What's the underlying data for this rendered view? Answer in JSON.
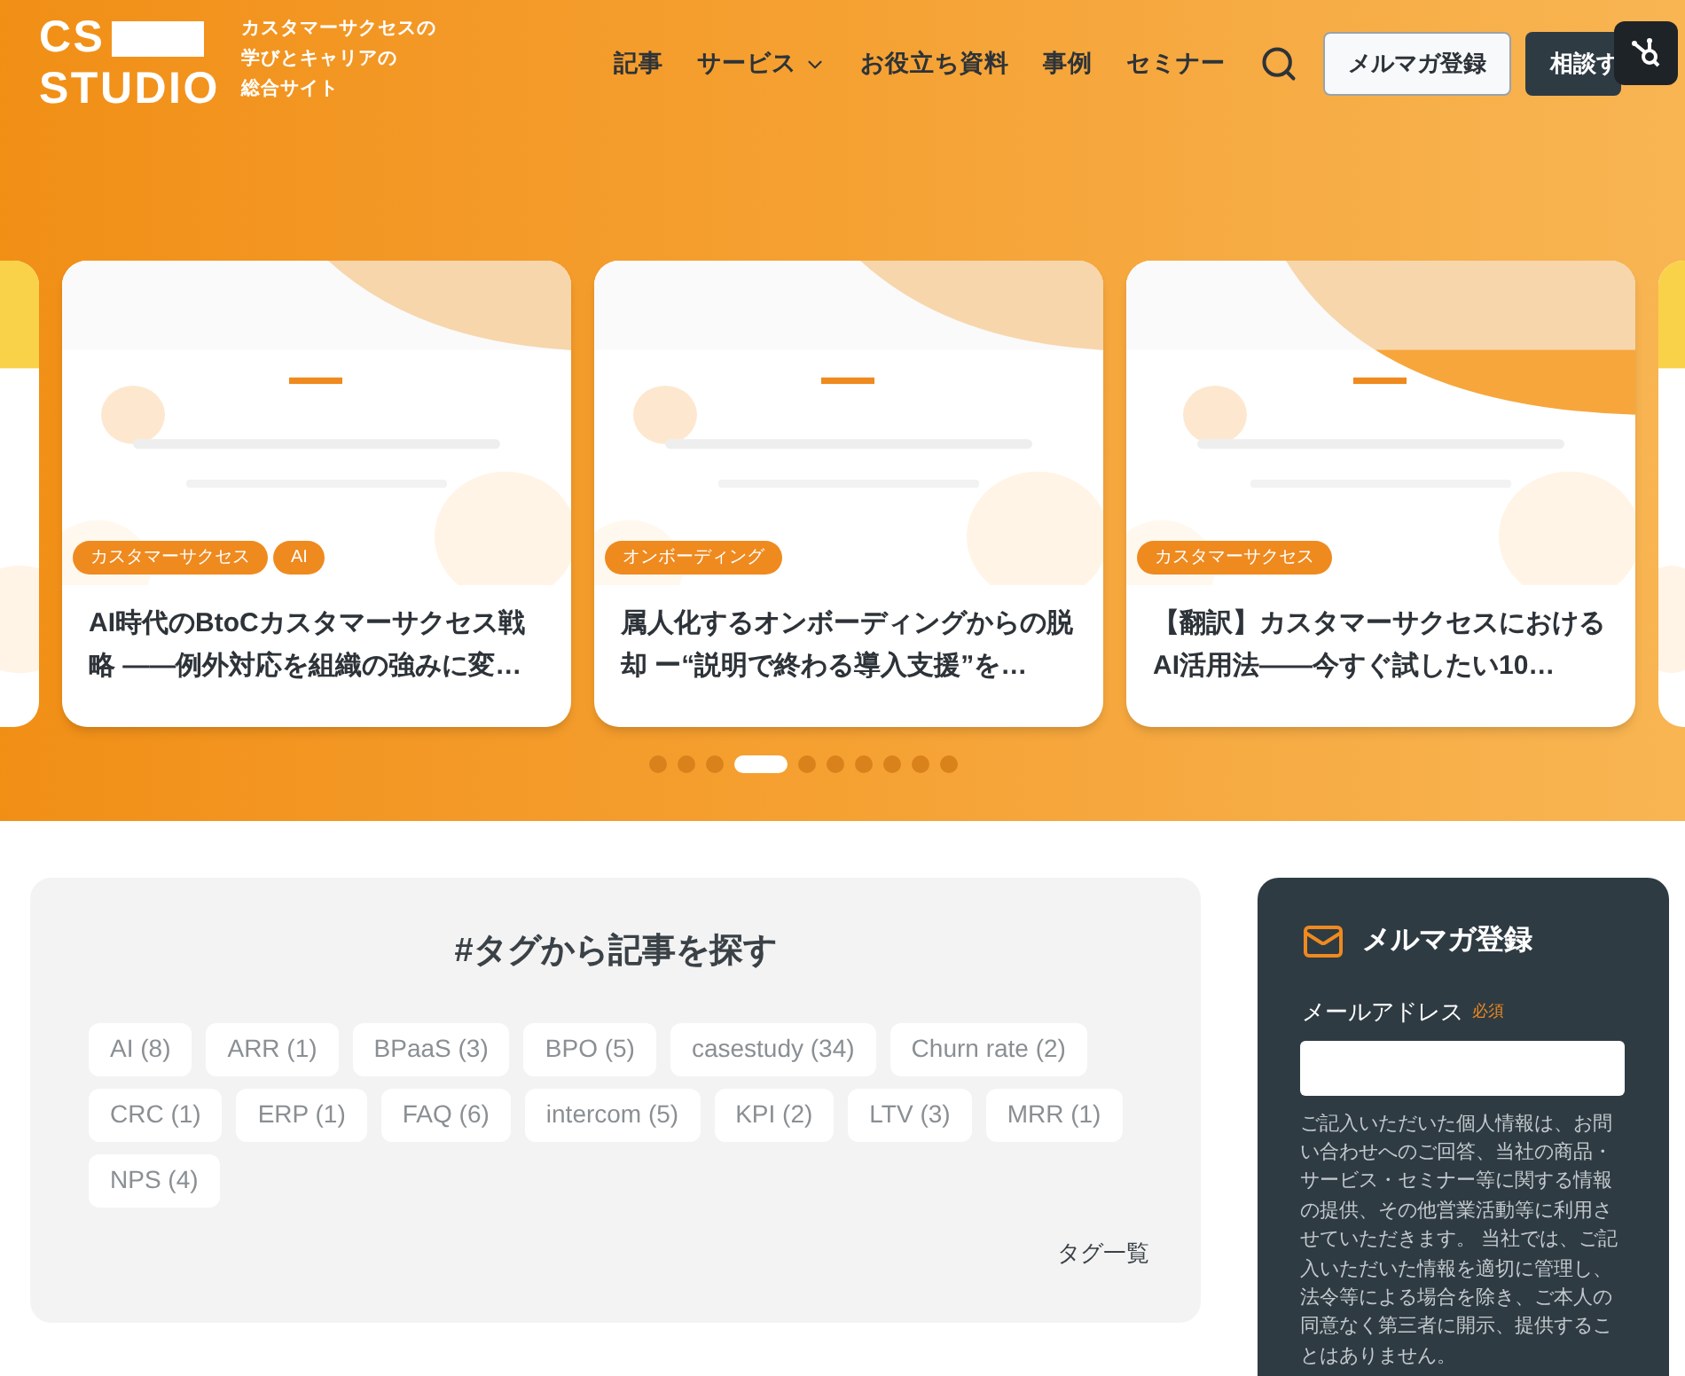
{
  "header": {
    "logo_top": "CS",
    "logo_bottom": "STUDIO",
    "tagline": [
      "カスタマーサクセスの",
      "学びとキャリアの",
      "総合サイト"
    ],
    "nav": [
      {
        "label": "記事",
        "dropdown": false
      },
      {
        "label": "サービス",
        "dropdown": true
      },
      {
        "label": "お役立ち資料",
        "dropdown": false
      },
      {
        "label": "事例",
        "dropdown": false
      },
      {
        "label": "セミナー",
        "dropdown": false
      }
    ],
    "newsletter_button": "メルマガ登録",
    "contact_button": "相談す"
  },
  "carousel": {
    "cards": [
      {
        "tags": [
          "カスタマーサクセス",
          "AI"
        ],
        "title": "AI時代のBtoCカスタマーサクセス戦略 ――例外対応を組織の強みに変…"
      },
      {
        "tags": [
          "オンボーディング"
        ],
        "title": "属人化するオンボーディングからの脱却 ー“説明で終わる導入支援”を…"
      },
      {
        "tags": [
          "カスタマーサクセス"
        ],
        "title": "【翻訳】カスタマーサクセスにおけるAI活用法――今すぐ試したい10…"
      }
    ],
    "dots": [
      {
        "selected": false
      },
      {
        "selected": false
      },
      {
        "selected": false
      },
      {
        "selected": true
      },
      {
        "selected": false
      },
      {
        "selected": false
      },
      {
        "selected": false
      },
      {
        "selected": false
      },
      {
        "selected": false
      },
      {
        "selected": false
      }
    ]
  },
  "tag_search": {
    "title": "#タグから記事を探す",
    "tags": [
      "AI (8)",
      "ARR (1)",
      "BPaaS (3)",
      "BPO (5)",
      "casestudy (34)",
      "Churn rate (2)",
      "CRC (1)",
      "ERP (1)",
      "FAQ (6)",
      "intercom (5)",
      "KPI (2)",
      "LTV (3)",
      "MRR (1)",
      "NPS (4)"
    ],
    "all_tags_link": "タグ一覧"
  },
  "newsletter": {
    "title": "メルマガ登録",
    "email_label": "メールアドレス",
    "required": "必須",
    "notice": "ご記入いただいた個人情報は、お問い合わせへのご回答、当社の商品・サービス・セミナー等に関する情報の提供、その他営業活動等に利用させていただきます。 当社では、ご記入いただいた情報を適切に管理し、法令等による場合を除き、ご本人の同意なく第三者に開示、提供することはありません。"
  }
}
